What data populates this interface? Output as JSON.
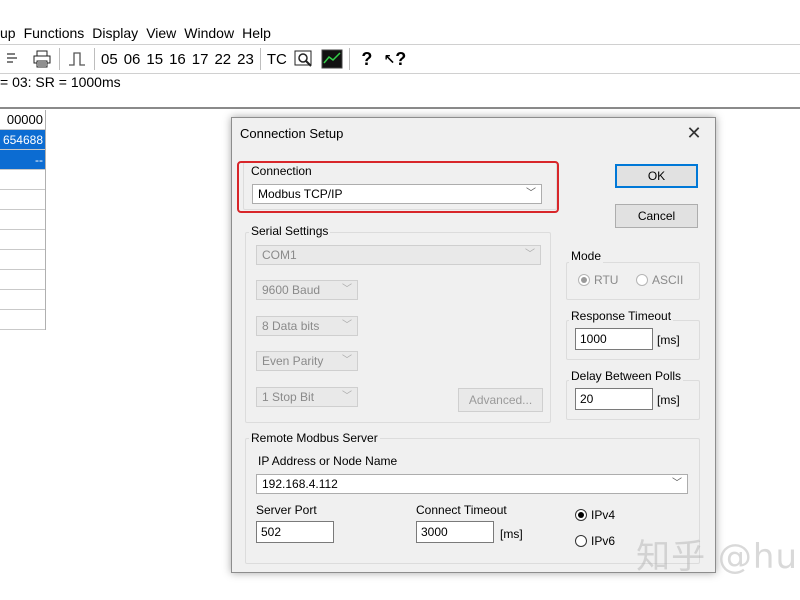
{
  "menu": [
    "up",
    "Functions",
    "Display",
    "View",
    "Window",
    "Help"
  ],
  "toolbar": {
    "numbers": [
      "05",
      "06",
      "15",
      "16",
      "17",
      "22",
      "23"
    ],
    "tc_label": "TC",
    "help_label": "?",
    "whats_this_label": "?"
  },
  "status": "= 03: SR = 1000ms",
  "grid": {
    "header": "00000",
    "selected_value": "654688",
    "second_value": "--"
  },
  "dialog": {
    "title": "Connection Setup",
    "ok_label": "OK",
    "cancel_label": "Cancel",
    "connection": {
      "label": "Connection",
      "value": "Modbus TCP/IP"
    },
    "serial": {
      "label": "Serial Settings",
      "port": "COM1",
      "baud": "9600 Baud",
      "data_bits": "8 Data bits",
      "parity": "Even Parity",
      "stop_bits": "1 Stop Bit",
      "advanced_label": "Advanced..."
    },
    "mode": {
      "label": "Mode",
      "rtu": "RTU",
      "ascii": "ASCII",
      "selected": "RTU"
    },
    "response_timeout": {
      "label": "Response Timeout",
      "value": "1000",
      "unit": "[ms]"
    },
    "delay_polls": {
      "label": "Delay Between Polls",
      "value": "20",
      "unit": "[ms]"
    },
    "remote": {
      "label": "Remote Modbus Server",
      "ip_label": "IP Address or Node Name",
      "ip_value": "192.168.4.112",
      "port_label": "Server Port",
      "port_value": "502",
      "connect_timeout_label": "Connect Timeout",
      "connect_timeout_value": "3000",
      "connect_timeout_unit": "[ms]",
      "ipv4": "IPv4",
      "ipv6": "IPv6",
      "selected_ip_version": "IPv4"
    }
  },
  "watermark": "知乎 @hu",
  "colors": {
    "highlight": "#d8262a",
    "selection": "#0c6cd2",
    "accent": "#0078d7"
  }
}
